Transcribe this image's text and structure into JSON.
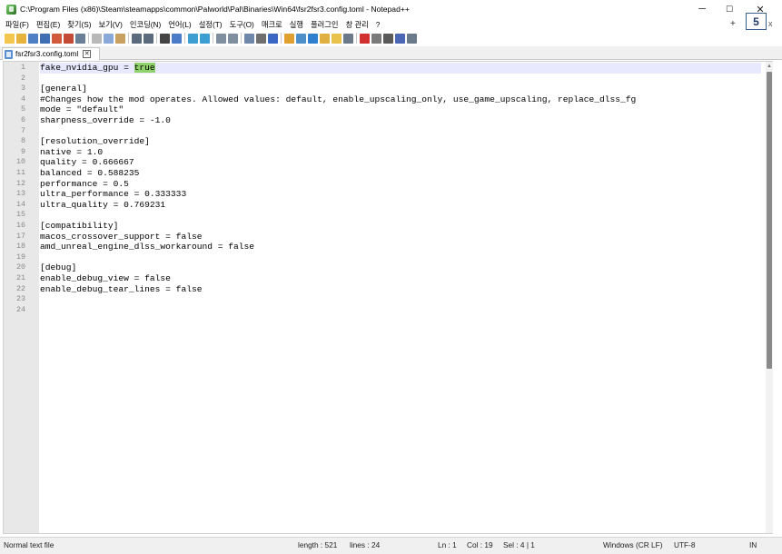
{
  "window": {
    "title": "C:\\Program Files (x86)\\Steam\\steamapps\\common\\Palworld\\Pal\\Binaries\\Win64\\fsr2fsr3.config.toml - Notepad++",
    "minimize": "─",
    "maximize": "☐",
    "close": "✕"
  },
  "menu": {
    "items": [
      "파일(F)",
      "편집(E)",
      "찾기(S)",
      "보기(V)",
      "인코딩(N)",
      "언어(L)",
      "설정(T)",
      "도구(O)",
      "매크로",
      "실행",
      "플러그인",
      "창 관리",
      "?"
    ],
    "plus": "+",
    "badge": "5",
    "close": "x"
  },
  "toolbar": {
    "icons": [
      {
        "name": "new-file-icon",
        "color": "#f3c74d"
      },
      {
        "name": "open-file-icon",
        "color": "#e6b43c"
      },
      {
        "name": "save-icon",
        "color": "#4d7fc4"
      },
      {
        "name": "save-all-icon",
        "color": "#3f6eb3"
      },
      {
        "name": "close-icon",
        "color": "#d25a3c"
      },
      {
        "name": "close-all-icon",
        "color": "#c44a35"
      },
      {
        "name": "print-icon",
        "color": "#6a7f95"
      },
      {
        "name": "sep"
      },
      {
        "name": "cut-icon",
        "color": "#b8b8b8"
      },
      {
        "name": "copy-icon",
        "color": "#8aa8d8"
      },
      {
        "name": "paste-icon",
        "color": "#c9a060"
      },
      {
        "name": "sep"
      },
      {
        "name": "undo-icon",
        "color": "#5b6b7d"
      },
      {
        "name": "redo-icon",
        "color": "#5b6b7d"
      },
      {
        "name": "sep"
      },
      {
        "name": "find-icon",
        "color": "#444444"
      },
      {
        "name": "replace-icon",
        "color": "#4b7cc8"
      },
      {
        "name": "sep"
      },
      {
        "name": "zoom-in-icon",
        "color": "#3d9fd1"
      },
      {
        "name": "zoom-out-icon",
        "color": "#3d9fd1"
      },
      {
        "name": "sep"
      },
      {
        "name": "sync-vertical-icon",
        "color": "#7f8fa0"
      },
      {
        "name": "sync-horizontal-icon",
        "color": "#7f8fa0"
      },
      {
        "name": "sep"
      },
      {
        "name": "word-wrap-icon",
        "color": "#6f87a8"
      },
      {
        "name": "show-all-chars-icon",
        "color": "#6f6f6f"
      },
      {
        "name": "indent-guide-icon",
        "color": "#3a66c4"
      },
      {
        "name": "sep"
      },
      {
        "name": "udl-icon",
        "color": "#e0a030"
      },
      {
        "name": "document-map-icon",
        "color": "#4d8fc8"
      },
      {
        "name": "function-list-icon",
        "color": "#2f7fd1"
      },
      {
        "name": "folder-workspace-icon",
        "color": "#e0b040"
      },
      {
        "name": "monitoring-icon",
        "color": "#e8c24a"
      },
      {
        "name": "eye-icon",
        "color": "#6a7a8a"
      },
      {
        "name": "sep"
      },
      {
        "name": "record-macro-icon",
        "color": "#d03030"
      },
      {
        "name": "stop-macro-icon",
        "color": "#7a7a7a"
      },
      {
        "name": "play-macro-icon",
        "color": "#5a5a5a"
      },
      {
        "name": "run-macro-multiple-icon",
        "color": "#4a66b4"
      },
      {
        "name": "save-macro-icon",
        "color": "#6a7a8a"
      }
    ]
  },
  "tab": {
    "label": "fsr2fsr3.config.toml",
    "close": "✕"
  },
  "editor": {
    "lines": [
      "fake_nvidia_gpu = true",
      "",
      "[general]",
      "#Changes how the mod operates. Allowed values: default, enable_upscaling_only, use_game_upscaling, replace_dlss_fg",
      "mode = \"default\"",
      "sharpness_override = -1.0",
      "",
      "[resolution_override]",
      "native = 1.0",
      "quality = 0.666667",
      "balanced = 0.588235",
      "performance = 0.5",
      "ultra_performance = 0.333333",
      "ultra_quality = 0.769231",
      "",
      "[compatibility]",
      "macos_crossover_support = false",
      "amd_unreal_engine_dlss_workaround = false",
      "",
      "[debug]",
      "enable_debug_view = false",
      "enable_debug_tear_lines = false",
      "",
      ""
    ],
    "line_numbers": [
      "1",
      "2",
      "3",
      "4",
      "5",
      "6",
      "7",
      "8",
      "9",
      "10",
      "11",
      "12",
      "13",
      "14",
      "15",
      "16",
      "17",
      "18",
      "19",
      "20",
      "21",
      "22",
      "23",
      "24"
    ],
    "first_line_prefix": "fake_nvidia_gpu = ",
    "first_line_selection": "true",
    "highlight_color": "#8fd16a"
  },
  "status": {
    "file_type": "Normal text file",
    "length": "length : 521",
    "lines": "lines : 24",
    "ln": "Ln : 1",
    "col": "Col : 19",
    "sel": "Sel : 4 | 1",
    "eol": "Windows (CR LF)",
    "encoding": "UTF-8",
    "mode": "IN"
  }
}
